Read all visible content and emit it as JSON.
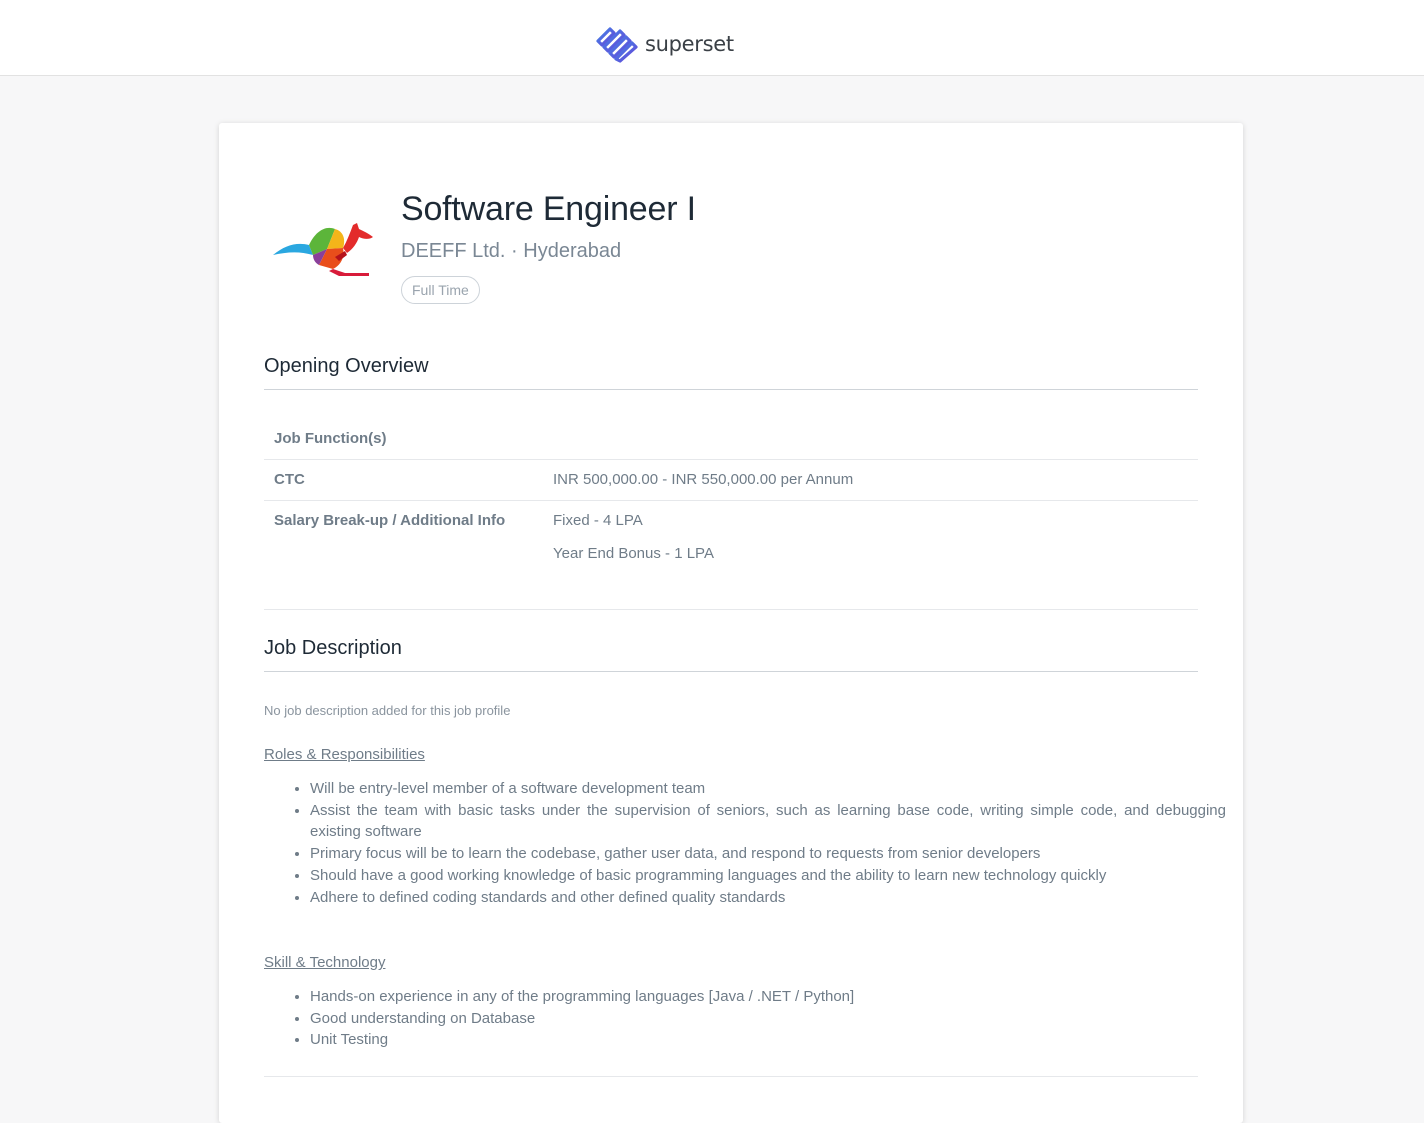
{
  "header": {
    "brand_name": "superset"
  },
  "job": {
    "title": "Software Engineer I",
    "company": "DEEFF Ltd.",
    "separator": "·",
    "location": "Hyderabad",
    "employment_type": "Full Time"
  },
  "overview": {
    "heading": "Opening Overview",
    "rows": [
      {
        "label": "Job Function(s)",
        "values": []
      },
      {
        "label": "CTC",
        "values": [
          "INR 500,000.00 - INR 550,000.00 per Annum"
        ]
      },
      {
        "label": "Salary Break-up / Additional Info",
        "values": [
          "Fixed - 4 LPA",
          "Year End Bonus - 1 LPA"
        ]
      }
    ]
  },
  "description": {
    "heading": "Job Description",
    "empty_note": "No job description added for this job profile",
    "roles_heading": "Roles & Responsibilities",
    "roles": [
      "Will be entry-level member of a software development team",
      "Assist the team with basic tasks under the supervision of seniors, such as learning base code, writing simple code, and debugging existing software",
      "Primary focus will be to learn the codebase, gather user data, and respond to requests from senior developers",
      "Should have a good working knowledge of basic programming languages and the ability to learn new technology quickly",
      "Adhere to defined coding standards and other defined quality standards"
    ],
    "skills_heading": "Skill & Technology",
    "skills": [
      "Hands-on experience in any of the programming languages [Java / .NET / Python]",
      "Good understanding on Database",
      "Unit Testing"
    ]
  },
  "icons": {
    "brand_logo": "superset-logo-icon",
    "company_logo": "kangaroo-logo-icon"
  },
  "colors": {
    "brand_accent": "#4f5bd5",
    "title_text": "#1e2a36",
    "muted_text": "#6f7c88"
  }
}
